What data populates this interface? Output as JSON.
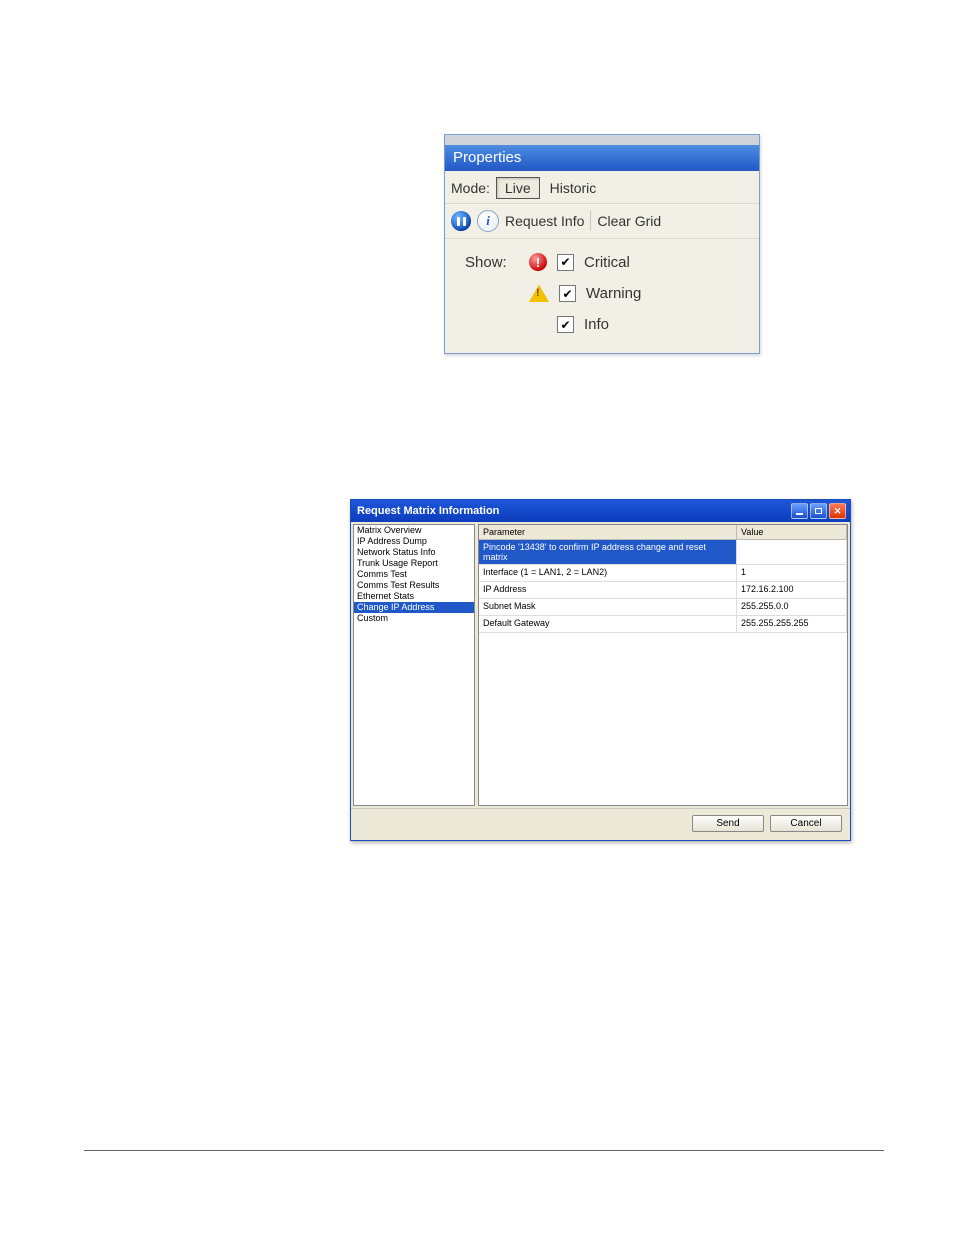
{
  "properties": {
    "title": "Properties",
    "mode_label": "Mode:",
    "mode_live": "Live",
    "mode_historic": "Historic",
    "request_info": "Request Info",
    "clear_grid": "Clear Grid",
    "show_label": "Show:",
    "filters": {
      "critical": "Critical",
      "warning": "Warning",
      "info": "Info"
    }
  },
  "dialog": {
    "title": "Request Matrix Information",
    "sidebar": [
      "Matrix Overview",
      "IP Address Dump",
      "Network Status Info",
      "Trunk Usage Report",
      "Comms Test",
      "Comms Test Results",
      "Ethernet Stats",
      "Change IP Address",
      "Custom"
    ],
    "grid": {
      "header_param": "Parameter",
      "header_value": "Value",
      "rows": [
        {
          "param": "Pincode '13438' to confirm IP address change and reset matrix",
          "value": ""
        },
        {
          "param": "Interface (1 = LAN1, 2 = LAN2)",
          "value": "1"
        },
        {
          "param": "IP Address",
          "value": "172.16.2.100"
        },
        {
          "param": "Subnet Mask",
          "value": "255.255.0.0"
        },
        {
          "param": "Default Gateway",
          "value": "255.255.255.255"
        }
      ]
    },
    "buttons": {
      "send": "Send",
      "cancel": "Cancel"
    }
  }
}
